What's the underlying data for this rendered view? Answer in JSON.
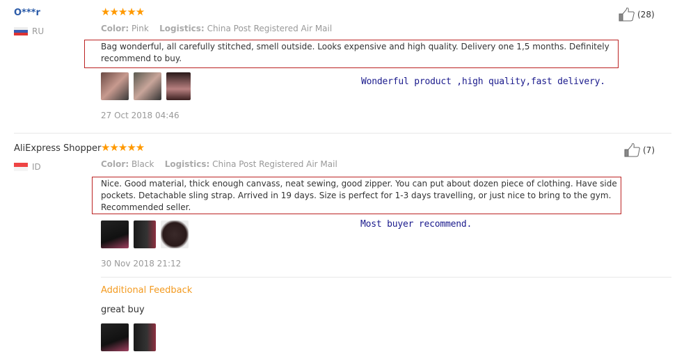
{
  "reviews": [
    {
      "user": "O***r",
      "country": "RU",
      "rating": 5,
      "stars": "★★★★★",
      "color_label": "Color:",
      "color": "Pink",
      "logistics_label": "Logistics:",
      "logistics": "China Post Registered Air Mail",
      "text": "Bag wonderful, all carefully stitched, smell outside. Looks expensive and high quality. Delivery one 1,5 months. Definitely recommend to buy.",
      "annotation": "Wonderful product ,high quality,fast delivery.",
      "date": "27 Oct 2018 04:46",
      "likes": "(28)"
    },
    {
      "user": "AliExpress Shopper",
      "country": "ID",
      "rating": 5,
      "stars": "★★★★★",
      "color_label": "Color:",
      "color": "Black",
      "logistics_label": "Logistics:",
      "logistics": "China Post Registered Air Mail",
      "text": "Nice. Good material, thick enough canvass, neat sewing, good zipper. You can put about dozen piece of clothing. Have side pockets. Detachable sling strap. Arrived in 19 days. Size is perfect for 1-3 days travelling, or just nice to bring to the gym. Recommended seller.",
      "annotation": "Most buyer recommend.",
      "date": "30 Nov 2018 21:12",
      "likes": "(7)",
      "additional": {
        "title": "Additional Feedback",
        "text": "great buy"
      }
    }
  ],
  "colors": {
    "highlight_box": "#bb2222",
    "star": "#ff9900",
    "annotation": "#1a1a8c",
    "additional_title": "#f39a1f"
  }
}
